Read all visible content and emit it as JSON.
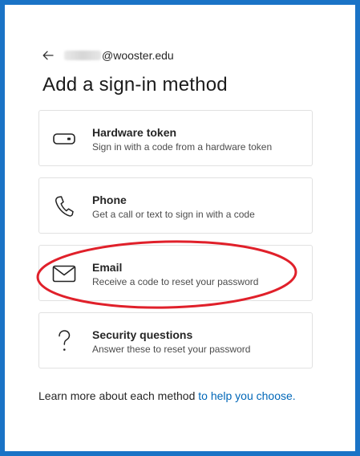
{
  "header": {
    "back_icon": "arrow-left-icon",
    "account_domain": "@wooster.edu"
  },
  "page": {
    "title": "Add a sign-in method"
  },
  "methods": [
    {
      "name": "hardware-token",
      "icon": "hardware-token-icon",
      "title": "Hardware token",
      "description": "Sign in with a code from a hardware token"
    },
    {
      "name": "phone",
      "icon": "phone-icon",
      "title": "Phone",
      "description": "Get a call or text to sign in with a code"
    },
    {
      "name": "email",
      "icon": "envelope-icon",
      "title": "Email",
      "description": "Receive a code to reset your password"
    },
    {
      "name": "security-questions",
      "icon": "question-mark-icon",
      "title": "Security questions",
      "description": "Answer these to reset your password"
    }
  ],
  "footer": {
    "text": "Learn more about each method ",
    "link": "to help you choose."
  },
  "colors": {
    "frame": "#1a73c6",
    "highlight": "#e0202a",
    "link": "#0067b8"
  }
}
